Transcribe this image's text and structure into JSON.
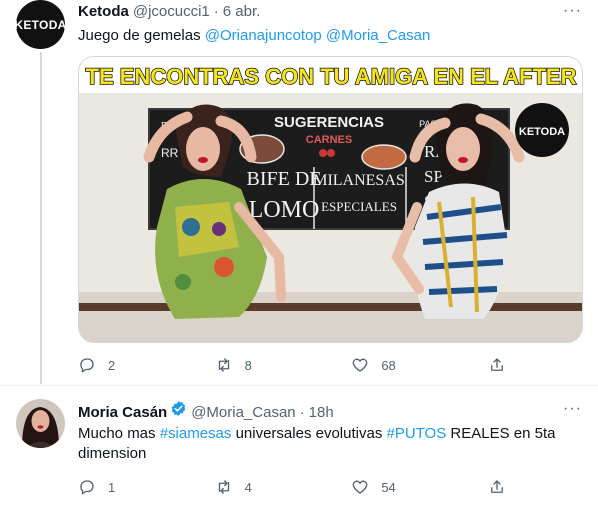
{
  "tweet1": {
    "avatar_text": "KETODA",
    "name": "Ketoda",
    "handle": "@jcocucci1",
    "separator": "·",
    "time": "6 abr.",
    "more": "···",
    "text_prefix": "Juego de gemelas ",
    "mention1": "@Orianajuncotop",
    "mention2": "@Moria_Casan",
    "media": {
      "banner": "TE ENCONTRAS CON TU AMIGA EN EL AFTER",
      "watermark": "KETODA",
      "board_title": "SUGERENCIAS",
      "board_carnes": "CARNES",
      "board_bife": "BIFE DE",
      "board_lomo": "LOMO",
      "board_milanesas": "MILANESAS",
      "board_especiales": "ESPECIALES",
      "board_pastas": "PASTAS CASERAS",
      "board_ravi": "RAV",
      "board_sp": "SP",
      "board_so": "SO",
      "board_left_top": "EN",
      "board_left_mid": "RR"
    },
    "replies": "2",
    "retweets": "8",
    "likes": "68"
  },
  "tweet2": {
    "name": "Moria Casán",
    "handle": "@Moria_Casan",
    "separator": "·",
    "time": "18h",
    "more": "···",
    "text_p1": "Mucho mas ",
    "hashtag1": "#siamesas",
    "text_p2": " universales evolutivas ",
    "hashtag2": "#PUTOS",
    "text_p3": " REALES  en 5ta",
    "text_line2": "dimension",
    "replies": "1",
    "retweets": "4",
    "likes": "54"
  },
  "colors": {
    "accent": "#1d9bf0",
    "secondary_text": "#536471",
    "banner_yellow": "#f5e51b"
  },
  "icons": [
    "reply-icon",
    "retweet-icon",
    "like-icon",
    "share-icon",
    "verified-icon",
    "more-icon"
  ]
}
